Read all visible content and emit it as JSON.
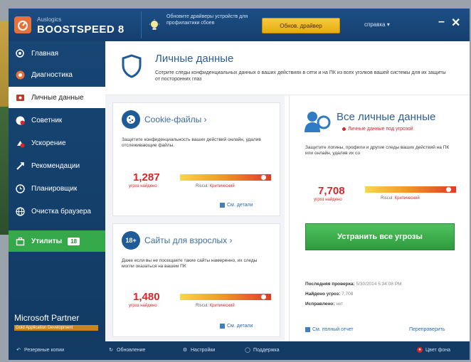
{
  "titlebar": {
    "logo_small": "Auslogics",
    "logo_big": "BOOSTSPEED 8",
    "notice": "Обновите драйверы устройств для профилактики сбоев",
    "refresh_button": "Обнов. драйвер",
    "help_menu": "справка ▾",
    "minimize": "–",
    "close": "✕"
  },
  "sidebar": {
    "items": [
      {
        "label": "Главная",
        "icon": "home-icon"
      },
      {
        "label": "Диагностика",
        "icon": "diagnostics-icon"
      },
      {
        "label": "Личные данные",
        "icon": "privacy-icon"
      },
      {
        "label": "Советник",
        "icon": "advisor-icon"
      },
      {
        "label": "Ускорение",
        "icon": "speedup-icon"
      },
      {
        "label": "Рекомендации",
        "icon": "recommendations-icon"
      },
      {
        "label": "Планировщик",
        "icon": "scheduler-icon"
      },
      {
        "label": "Очистка браузера",
        "icon": "browser-icon"
      },
      {
        "label": "Утилиты",
        "icon": "utilities-icon",
        "count": "18"
      }
    ],
    "partner": "Microsoft Partner",
    "partner_sub": "Gold Application Development"
  },
  "page": {
    "title": "Личные данные",
    "description": "Сотрите следы конфиденциальных данных о ваших действиях в сети и на ПК из всех уголков вашей системы для их защиты от посторонних глаз"
  },
  "cards": [
    {
      "title": "Cookie-файлы ›",
      "description": "Защитите конфиденциальность ваших действий онлайн, удалив отслеживающие файлы.",
      "count": "1,287",
      "count_label": "угроз найдено",
      "risk_label": "Riscul:",
      "risk_value": "Критический",
      "link": "См. детали"
    },
    {
      "title": "Сайты для взрослых ›",
      "icon_text": "18+",
      "description": "Даже если вы не посещаете такие сайты намеренно, их следы могли оказаться на вашем ПК",
      "count": "1,480",
      "count_label": "угроз найдено",
      "risk_label": "Riscul:",
      "risk_value": "Критический",
      "link": "См. детали"
    }
  ],
  "summary": {
    "title": "Все личные данные",
    "subtitle": "Личные данные под угрозой",
    "description": "Защитите логины, профили и другие следы ваших действий на ПК или онлайн, удалив их со",
    "count": "7,708",
    "count_label": "угроз найдено",
    "risk_label": "Riscul:",
    "risk_value": "Критический",
    "fix_button": "Устранить все угрозы",
    "last_check_label": "Последняя проверка:",
    "last_check_value": "5/30/2014 5:34:08 PM",
    "found_label": "Найдено угроз:",
    "found_value": "7,708",
    "fixed_label": "Исправлено:",
    "fixed_value": "нет",
    "full_report_link": "См. полный отчет",
    "rescan_link": "Перепроверить"
  },
  "statusbar": {
    "backups": "Резервные копии",
    "updates": "Обновление",
    "settings": "Настройки",
    "support": "Поддержка",
    "color_scheme": "Цвет фона"
  }
}
